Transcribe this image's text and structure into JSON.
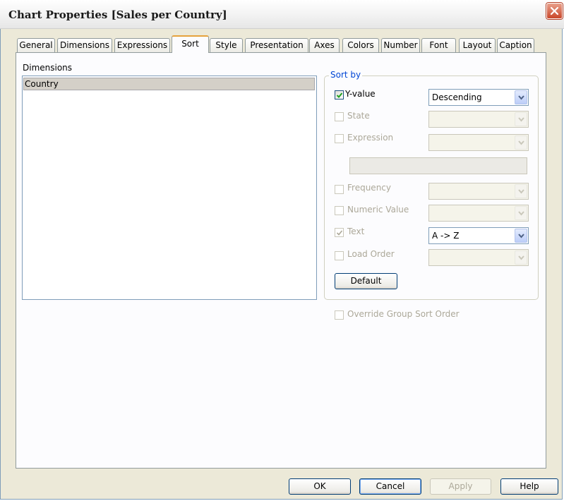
{
  "window": {
    "title": "Chart Properties [Sales per Country]",
    "accent_color": "#e6a23c",
    "close_icon": "close-icon"
  },
  "tabs": [
    {
      "label": "General"
    },
    {
      "label": "Dimensions"
    },
    {
      "label": "Expressions"
    },
    {
      "label": "Sort",
      "active": true
    },
    {
      "label": "Style"
    },
    {
      "label": "Presentation"
    },
    {
      "label": "Axes"
    },
    {
      "label": "Colors"
    },
    {
      "label": "Number"
    },
    {
      "label": "Font"
    },
    {
      "label": "Layout"
    },
    {
      "label": "Caption"
    }
  ],
  "dimensions": {
    "label": "Dimensions",
    "items": [
      "Country"
    ],
    "selected": "Country"
  },
  "sort_by": {
    "label": "Sort by",
    "y_value": {
      "label": "Y-value",
      "checked": true,
      "enabled": true,
      "option": "Descending"
    },
    "state": {
      "label": "State",
      "checked": false,
      "enabled": false,
      "option": ""
    },
    "expression": {
      "label": "Expression",
      "checked": false,
      "enabled": false,
      "option": "",
      "text": ""
    },
    "frequency": {
      "label": "Frequency",
      "checked": false,
      "enabled": false,
      "option": ""
    },
    "numeric_value": {
      "label": "Numeric Value",
      "checked": false,
      "enabled": false,
      "option": ""
    },
    "text": {
      "label": "Text",
      "checked": true,
      "enabled": false,
      "option": "A -> Z"
    },
    "load_order": {
      "label": "Load Order",
      "checked": false,
      "enabled": false,
      "option": ""
    },
    "default_button": "Default"
  },
  "override_group_sort": {
    "label": "Override Group Sort Order",
    "checked": false,
    "enabled": false
  },
  "buttons": {
    "ok": "OK",
    "cancel": "Cancel",
    "apply": "Apply",
    "help": "Help"
  }
}
